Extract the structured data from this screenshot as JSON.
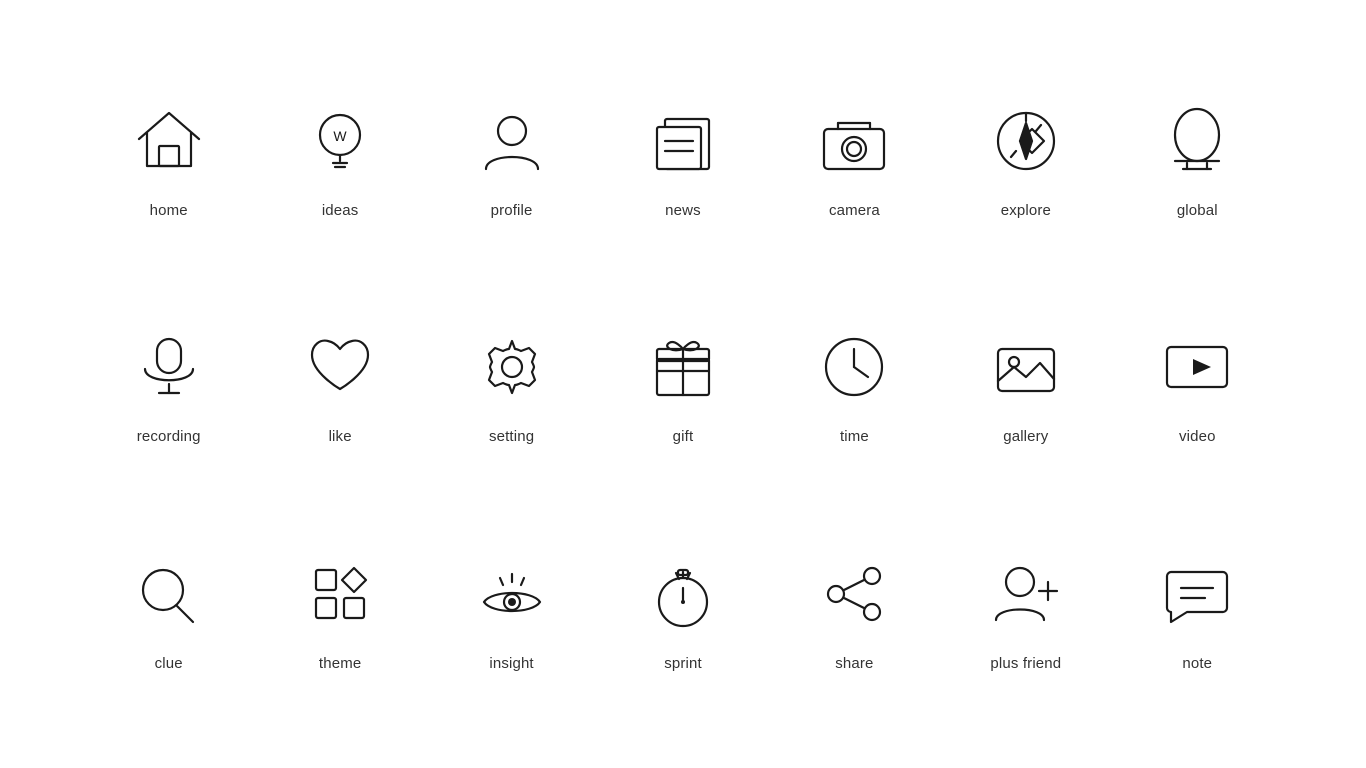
{
  "icons": [
    {
      "id": "home",
      "label": "home"
    },
    {
      "id": "ideas",
      "label": "ideas"
    },
    {
      "id": "profile",
      "label": "profile"
    },
    {
      "id": "news",
      "label": "news"
    },
    {
      "id": "camera",
      "label": "camera"
    },
    {
      "id": "explore",
      "label": "explore"
    },
    {
      "id": "global",
      "label": "global"
    },
    {
      "id": "recording",
      "label": "recording"
    },
    {
      "id": "like",
      "label": "like"
    },
    {
      "id": "setting",
      "label": "setting"
    },
    {
      "id": "gift",
      "label": "gift"
    },
    {
      "id": "time",
      "label": "time"
    },
    {
      "id": "gallery",
      "label": "gallery"
    },
    {
      "id": "video",
      "label": "video"
    },
    {
      "id": "clue",
      "label": "clue"
    },
    {
      "id": "theme",
      "label": "theme"
    },
    {
      "id": "insight",
      "label": "insight"
    },
    {
      "id": "sprint",
      "label": "sprint"
    },
    {
      "id": "share",
      "label": "share"
    },
    {
      "id": "plus-friend",
      "label": "plus friend"
    },
    {
      "id": "note",
      "label": "note"
    }
  ]
}
